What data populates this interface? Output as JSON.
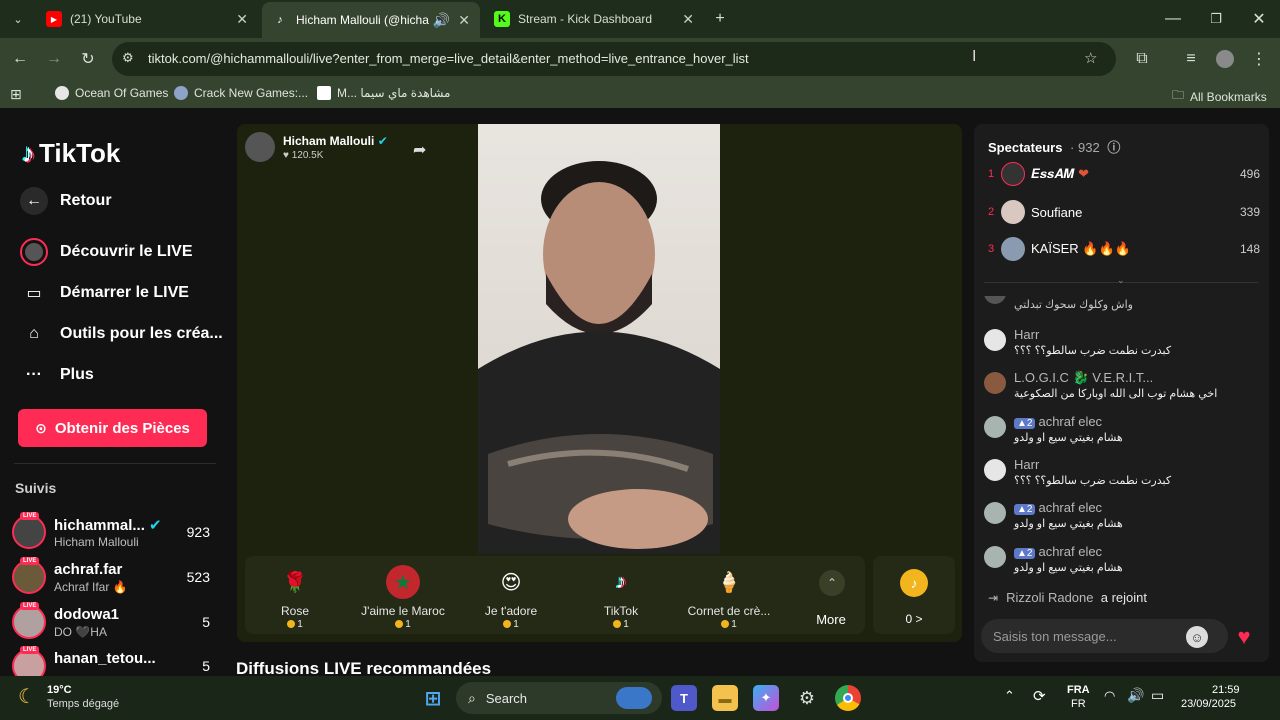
{
  "browser": {
    "tabs": [
      {
        "title": "(21) YouTube",
        "icon": "youtube-icon"
      },
      {
        "title": "Hicham Mallouli (@hichammallouli) - TikTok LIVE",
        "icon": "tiktok-icon"
      },
      {
        "title": "Stream - Kick Dashboard",
        "icon": "kick-icon"
      }
    ],
    "url": "tiktok.com/@hichammallouli/live?enter_from_merge=live_detail&enter_method=live_entrance_hover_list",
    "bookmarks": [
      "Ocean Of Games",
      "Crack New Games:...",
      "M...",
      "مشاهدة ماي سيما"
    ],
    "all_bookmarks": "All Bookmarks"
  },
  "sidebar": {
    "logo": "TikTok",
    "back": "Retour",
    "discover_live": "Découvrir le LIVE",
    "start_live": "Démarrer le LIVE",
    "creator_tools": "Outils pour les créa...",
    "more": "Plus",
    "coins_button": "Obtenir des Pièces",
    "follows_title": "Suivis",
    "follows": [
      {
        "name": "hichammal...",
        "sub": "Hicham Mallouli",
        "count": "923"
      },
      {
        "name": "achraf.far",
        "sub": "Achraf Ifar",
        "count": "523"
      },
      {
        "name": "dodowa1",
        "sub": "DO 🖤HA",
        "count": "5"
      },
      {
        "name": "hanan_tetou...",
        "sub": "",
        "count": "5"
      }
    ],
    "live_badge": "LIVE"
  },
  "live": {
    "host_name": "Hicham Mallouli",
    "host_likes": "120.5K",
    "gifts": [
      {
        "name": "Rose",
        "price": "1"
      },
      {
        "name": "J'aime le Maroc",
        "price": "1"
      },
      {
        "name": "Je t'adore",
        "price": "1"
      },
      {
        "name": "TikTok",
        "price": "1"
      },
      {
        "name": "Cornet de crè...",
        "price": "1"
      }
    ],
    "more_label": "More",
    "balance": "0 >",
    "recommended": "Diffusions LIVE recommandées"
  },
  "chat": {
    "viewers_title": "Spectateurs",
    "viewers_count": "932",
    "top": [
      {
        "rank": "1",
        "name": "𝑬𝒔𝒔𝑨𝑴",
        "score": "496"
      },
      {
        "rank": "2",
        "name": "Soufiane",
        "score": "339"
      },
      {
        "rank": "3",
        "name": "KAÏSER",
        "score": "148"
      }
    ],
    "partial_message": "واش وكلوك سحوك تبدلتي",
    "messages": [
      {
        "name": "Harr",
        "level": "",
        "text": "كبدرت نطمت ضرب سالطو؟؟ ؟؟؟"
      },
      {
        "name": "L.O.G.I.C 🐉 V.E.R.I.T...",
        "level": "",
        "text": "اخي هشام توب الى الله اوباركا من الصكوعية"
      },
      {
        "name": "achraf elec",
        "level": "2",
        "text": "هشام بغيتي سيع او ولدو"
      },
      {
        "name": "Harr",
        "level": "",
        "text": "كبدرت نطمت ضرب سالطو؟؟ ؟؟؟"
      },
      {
        "name": "achraf elec",
        "level": "2",
        "text": "هشام بغيتي سيع او ولدو"
      },
      {
        "name": "achraf elec",
        "level": "2",
        "text": "هشام بغيتي سيع او ولدو"
      }
    ],
    "joined_name": "Rizzoli Radone",
    "joined_text": "a rejoint",
    "input_placeholder": "Saisis ton message..."
  },
  "taskbar": {
    "weather_temp": "19°C",
    "weather_desc": "Temps dégagé",
    "search": "Search",
    "lang1": "FRA",
    "lang2": "FR",
    "time": "21:59",
    "date": "23/09/2025"
  },
  "colors": {
    "accent": "#fe2c55",
    "chrome": "#35442f",
    "coin": "#f2b51e"
  }
}
